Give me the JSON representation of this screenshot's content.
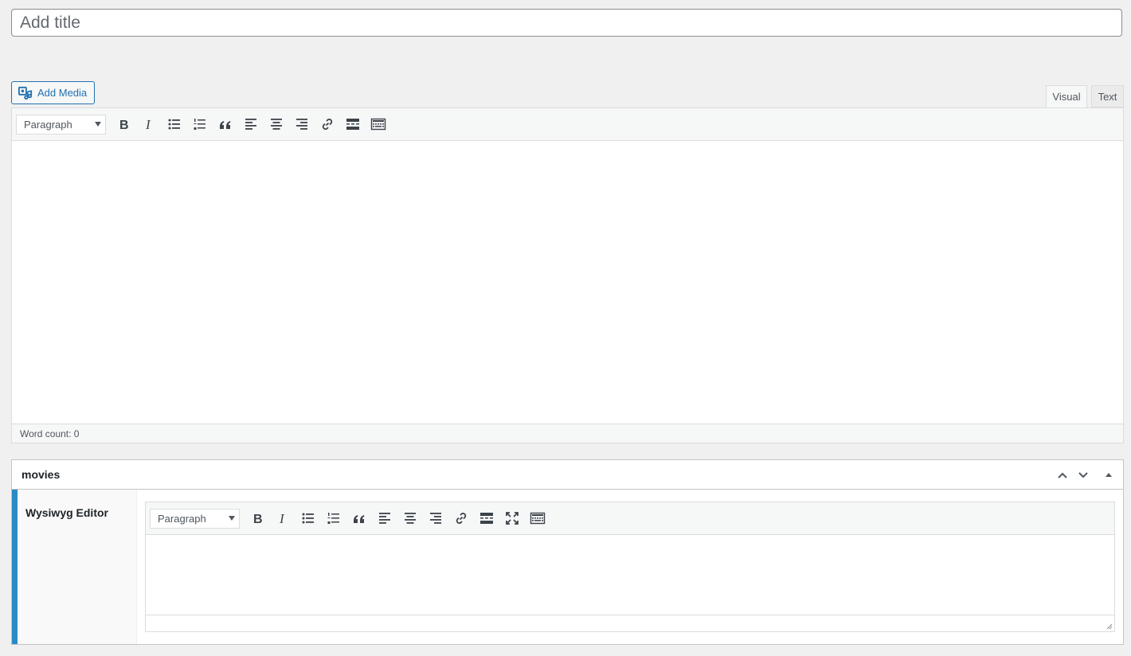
{
  "title": {
    "placeholder": "Add title",
    "value": ""
  },
  "media": {
    "add_media_label": "Add Media"
  },
  "tabs": {
    "visual": "Visual",
    "text": "Text"
  },
  "main_editor": {
    "format_value": "Paragraph",
    "word_count": "Word count: 0"
  },
  "metabox": {
    "title": "movies",
    "field_label": "Wysiwyg Editor",
    "format_value": "Paragraph"
  },
  "colors": {
    "accent": "#2271b1",
    "field_bar": "#2a8bc4"
  },
  "icons": [
    "media-icon",
    "bold-icon",
    "italic-icon",
    "bulleted-list-icon",
    "numbered-list-icon",
    "blockquote-icon",
    "align-left-icon",
    "align-center-icon",
    "align-right-icon",
    "link-icon",
    "read-more-icon",
    "toolbar-toggle-icon",
    "fullscreen-icon",
    "chevron-up-icon",
    "chevron-down-icon",
    "triangle-up-icon"
  ]
}
